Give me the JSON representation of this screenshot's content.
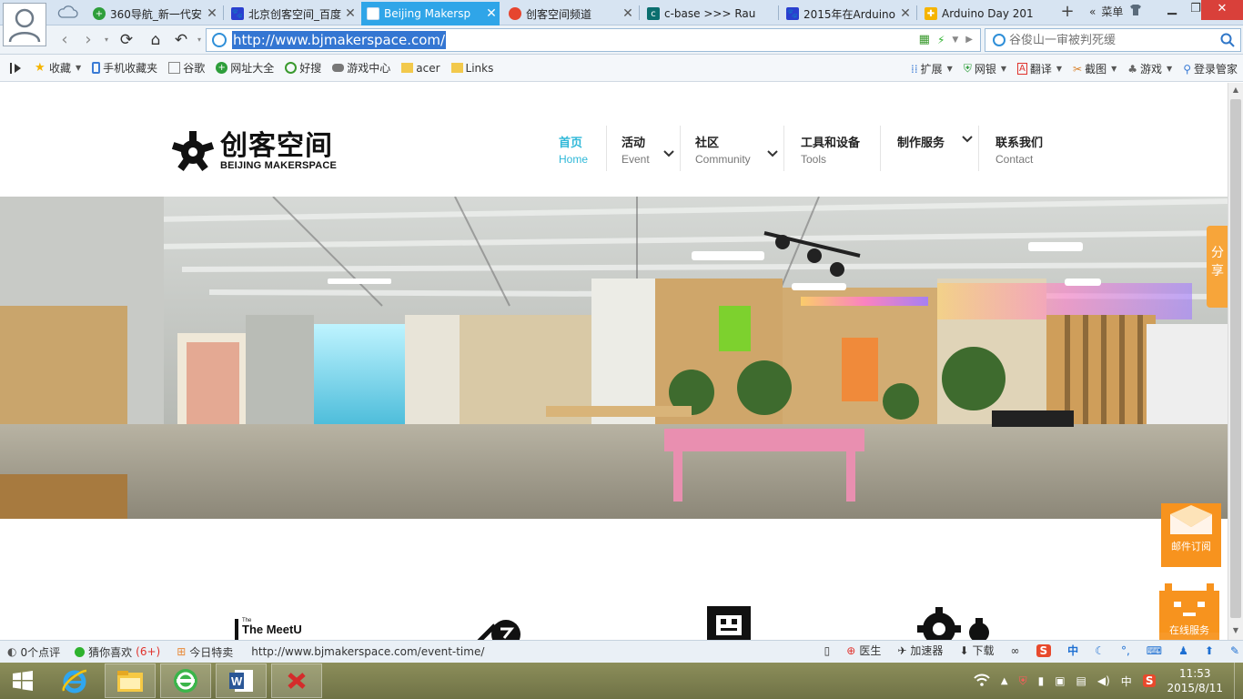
{
  "browser": {
    "tabs": [
      {
        "label": "360导航_新一代安",
        "favicon": "green-plus",
        "active": false
      },
      {
        "label": "北京创客空间_百度",
        "favicon": "baidu-paw",
        "active": false
      },
      {
        "label": "Beijing Makersp",
        "favicon": "page",
        "active": true
      },
      {
        "label": "创客空间频道",
        "favicon": "colorful",
        "active": false
      },
      {
        "label": "c-base >>> Rau",
        "favicon": "cbase",
        "active": false
      },
      {
        "label": "2015年在Arduino",
        "favicon": "baidu-paw",
        "active": false
      },
      {
        "label": "Arduino Day 201",
        "favicon": "arduino",
        "active": false
      }
    ],
    "new_tab": "+",
    "menu_label": "菜单",
    "address": {
      "url": "http://www.bjmakerspace.com/"
    },
    "search": {
      "placeholder": "谷俊山一审被判死缓"
    }
  },
  "bookmarks": {
    "items": [
      {
        "label": "收藏",
        "dropdown": true
      },
      {
        "label": "手机收藏夹"
      },
      {
        "label": "谷歌"
      },
      {
        "label": "网址大全"
      },
      {
        "label": "好搜"
      },
      {
        "label": "游戏中心"
      },
      {
        "label": "acer"
      },
      {
        "label": "Links"
      }
    ],
    "right": [
      "扩展",
      "网银",
      "翻译",
      "截图",
      "游戏",
      "登录管家"
    ]
  },
  "site": {
    "logo_cn": "创客空间",
    "logo_en": "BEIJING MAKERSPACE",
    "nav": [
      {
        "cn": "首页",
        "en": "Home",
        "active": true,
        "dropdown": false
      },
      {
        "cn": "活动",
        "en": "Event",
        "active": false,
        "dropdown": true
      },
      {
        "cn": "社区",
        "en": "Community",
        "active": false,
        "dropdown": true
      },
      {
        "cn": "工具和设备",
        "en": "Tools",
        "active": false,
        "dropdown": false
      },
      {
        "cn": "制作服务",
        "en": "",
        "active": false,
        "dropdown": true
      },
      {
        "cn": "联系我们",
        "en": "Contact",
        "active": false,
        "dropdown": false
      }
    ],
    "side_share": "分享",
    "side_mail": "邮件订阅",
    "side_robot": "在线服务",
    "features": {
      "meetup": "The MeetUP"
    }
  },
  "statusbar": {
    "reviews": "0个点评",
    "guess_label": "猜你喜欢",
    "guess_count": "(6+)",
    "deals": "今日特卖",
    "hover_url": "http://www.bjmakerspace.com/event-time/",
    "doctor": "医生",
    "accelerator": "加速器",
    "download": "下载",
    "ime": "中"
  },
  "taskbar": {
    "time": "11:53",
    "date": "2015/8/11",
    "ime": "中"
  },
  "colors": {
    "accent": "#2fb8d8",
    "tab_active": "#2fa5e8",
    "orange": "#f7931e"
  }
}
